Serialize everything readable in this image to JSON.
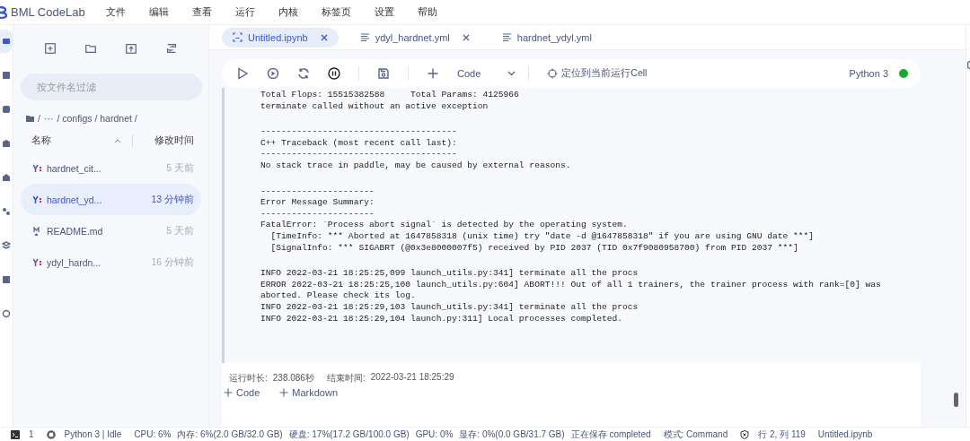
{
  "app": {
    "title": "BML CodeLab"
  },
  "menu": [
    "文件",
    "编辑",
    "查看",
    "运行",
    "内核",
    "标签页",
    "设置",
    "帮助"
  ],
  "rail": [
    {
      "selected": true
    },
    {
      "selected": false
    },
    {
      "selected": false
    },
    {
      "selected": false
    },
    {
      "selected": false
    },
    {
      "selected": false
    },
    {
      "selected": false
    },
    {
      "selected": false
    },
    {
      "selected": false
    }
  ],
  "file_panel": {
    "filter": {
      "placeholder": "按文件名过滤"
    },
    "breadcrumb": [
      "/",
      "···",
      "/ configs / hardnet /"
    ],
    "columns": [
      "名称",
      "修改时间"
    ],
    "files": [
      {
        "name": "hardnet_cit...",
        "kind": "yaml",
        "modified": "5 天前",
        "selected": false
      },
      {
        "name": "hardnet_yd...",
        "kind": "yaml",
        "modified": "13 分钟前",
        "selected": true
      },
      {
        "name": "README.md",
        "kind": "markdown",
        "modified": "5 天前",
        "selected": false
      },
      {
        "name": "ydyl_hardn...",
        "kind": "yaml",
        "modified": "16 分钟前",
        "selected": false
      }
    ]
  },
  "tabs": [
    {
      "label": "Untitled.ipynb",
      "kind": "notebook",
      "selected": true,
      "closable": true
    },
    {
      "label": "ydyl_hardnet.yml",
      "kind": "text",
      "selected": false,
      "closable": true
    },
    {
      "label": "hardnet_ydyl.yml",
      "kind": "text",
      "selected": false,
      "closable": false
    }
  ],
  "toolbar": {
    "cell_type": "Code",
    "locate": "定位到当前运行Cell",
    "kernel": "Python 3",
    "kernel_connected": true
  },
  "output": [
    {
      "lines": [
        "Total Flops: 15515382588     Total Params: 4125966",
        "terminate called without an active exception"
      ]
    },
    {
      "lines": [
        "--------------------------------------",
        "C++ Traceback (most recent call last):",
        "--------------------------------------",
        "No stack trace in paddle, may be caused by external reasons."
      ]
    },
    {
      "lines": [
        "----------------------",
        "Error Message Summary:",
        "----------------------",
        "FatalError: `Process abort signal` is detected by the operating system.",
        "  [TimeInfo: *** Aborted at 1647858318 (unix time) try \"date -d @1647858318\" if you are using GNU date ***]",
        "  [SignalInfo: *** SIGABRT (@0x3e8000007f5) received by PID 2037 (TID 0x7f9080958700) from PID 2037 ***]"
      ]
    },
    {
      "lines": [
        "INFO 2022-03-21 18:25:25,099 launch_utils.py:341] terminate all the procs",
        "ERROR 2022-03-21 18:25:25,100 launch_utils.py:604] ABORT!!! Out of all 1 trainers, the trainer process with rank=[0] was aborted. Please check its log.",
        "INFO 2022-03-21 18:25:29,103 launch_utils.py:341] terminate all the procs",
        "INFO 2022-03-21 18:25:29,104 launch.py:311] Local processes completed."
      ]
    }
  ],
  "run_info": [
    {
      "label": "运行时长:",
      "value": "238.086秒"
    },
    {
      "label": "结束时间:",
      "value": "2022-03-21 18:25:29"
    }
  ],
  "add_cell": [
    "Code",
    "Markdown"
  ],
  "status_bar": {
    "terminals": "1",
    "kernel": "Python 3 | Idle",
    "stats": [
      "CPU: 6%",
      "内存: 6%(2.0 GB/32.0 GB)",
      "硬盘: 17%(17.2 GB/100.0 GB)",
      "GPU: 0%",
      "显存: 0%(0.0 GB/31.7 GB)"
    ],
    "saving": "正在保存 completed",
    "mode": "模式: Command",
    "position": "行 2, 列 119",
    "file": "Untitled.ipynb"
  }
}
